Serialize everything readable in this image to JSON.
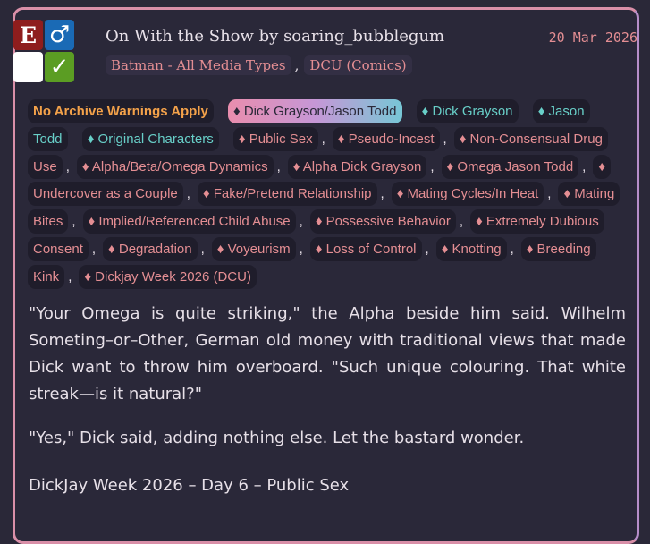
{
  "work": {
    "title": "On With the Show by soaring_bubblegum",
    "date": "20 Mar 2026",
    "symbols": {
      "rating": "E",
      "category": "♂",
      "warning": "",
      "complete": "✓"
    },
    "fandoms": [
      "Batman - All Media Types",
      "DCU (Comics)"
    ],
    "tags": [
      {
        "kind": "warning",
        "text": "No Archive Warnings Apply"
      },
      {
        "kind": "relationship",
        "text": "♦ Dick Grayson/Jason Todd"
      },
      {
        "kind": "character",
        "text": "♦ Dick Grayson"
      },
      {
        "kind": "character",
        "text": "♦ Jason Todd"
      },
      {
        "kind": "character",
        "text": "♦ Original Characters"
      },
      {
        "kind": "freeform",
        "text": "♦ Public Sex"
      },
      {
        "kind": "freeform",
        "text": "♦ Pseudo-Incest"
      },
      {
        "kind": "freeform",
        "text": "♦ Non-Consensual Drug Use"
      },
      {
        "kind": "freeform",
        "text": "♦ Alpha/Beta/Omega Dynamics"
      },
      {
        "kind": "freeform",
        "text": "♦ Alpha Dick Grayson"
      },
      {
        "kind": "freeform",
        "text": "♦ Omega Jason Todd"
      },
      {
        "kind": "freeform",
        "text": "♦ Undercover as a Couple"
      },
      {
        "kind": "freeform",
        "text": "♦ Fake/Pretend Relationship"
      },
      {
        "kind": "freeform",
        "text": "♦ Mating Cycles/In Heat"
      },
      {
        "kind": "freeform",
        "text": "♦ Mating Bites"
      },
      {
        "kind": "freeform",
        "text": "♦ Implied/Referenced Child Abuse"
      },
      {
        "kind": "freeform",
        "text": "♦ Possessive Behavior"
      },
      {
        "kind": "freeform",
        "text": "♦ Extremely Dubious Consent"
      },
      {
        "kind": "freeform",
        "text": "♦ Degradation"
      },
      {
        "kind": "freeform",
        "text": "♦ Voyeurism"
      },
      {
        "kind": "freeform",
        "text": "♦ Loss of Control"
      },
      {
        "kind": "freeform",
        "text": "♦ Knotting"
      },
      {
        "kind": "freeform",
        "text": "♦ Breeding Kink"
      },
      {
        "kind": "freeform",
        "text": "♦ Dickjay Week 2026 (DCU)"
      }
    ],
    "summary": [
      "\"Your Omega is quite striking,\" the Alpha beside him said. Wilhelm Someting–or–Other, German old money with traditional views that made Dick want to throw him overboard. \"Such unique colouring. That white streak—is it natural?\"",
      "\"Yes,\" Dick said, adding nothing else. Let the bastard wonder."
    ],
    "series_line": "DickJay Week 2026 – Day 6 – Public Sex"
  }
}
